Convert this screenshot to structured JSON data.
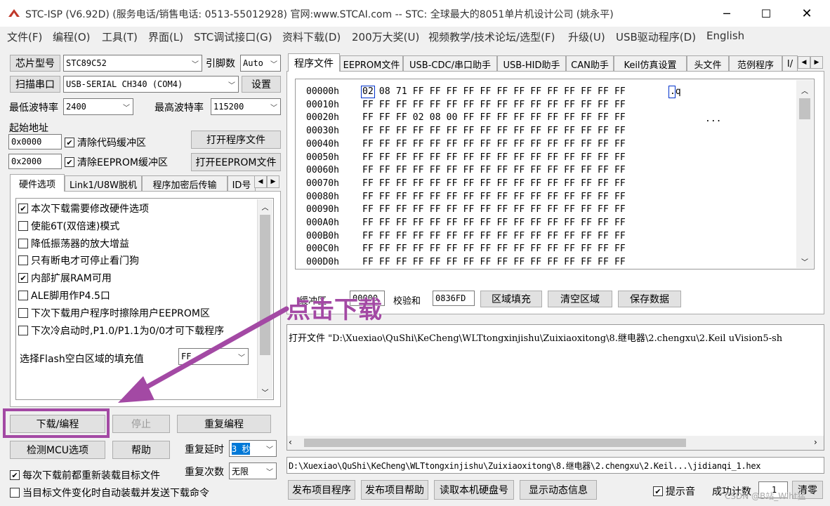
{
  "window": {
    "title": "STC-ISP (V6.92D) (服务电话/销售电话: 0513-55012928) 官网:www.STCAI.com  -- STC: 全球最大的8051单片机设计公司 (姚永平)"
  },
  "menu": [
    "文件(F)",
    "编程(O)",
    "工具(T)",
    "界面(L)",
    "STC调试接口(G)",
    "资料下载(D)",
    "200万大奖(U)",
    "视频教学/技术论坛/选型(F)",
    "升级(U)",
    "USB驱动程序(D)",
    "English"
  ],
  "left": {
    "chip_btn": "芯片型号",
    "chip_value": "STC89C52",
    "pin_label": "引脚数",
    "pin_value": "Auto",
    "scan_btn": "扫描串口",
    "port_value": "USB-SERIAL CH340 (COM4)",
    "settings_btn": "设置",
    "min_baud_label": "最低波特率",
    "min_baud_value": "2400",
    "max_baud_label": "最高波特率",
    "max_baud_value": "115200",
    "start_addr_label": "起始地址",
    "addr1": "0x0000",
    "clear_code": "清除代码缓冲区",
    "open_prog_btn": "打开程序文件",
    "addr2": "0x2000",
    "clear_eeprom": "清除EEPROM缓冲区",
    "open_eeprom_btn": "打开EEPROM文件",
    "tabs": [
      "硬件选项",
      "Link1/U8W脱机",
      "程序加密后传输",
      "ID号"
    ],
    "hw_options": [
      {
        "label": "本次下载需要修改硬件选项",
        "checked": true
      },
      {
        "label": "使能6T(双倍速)模式",
        "checked": false
      },
      {
        "label": "降低振荡器的放大增益",
        "checked": false
      },
      {
        "label": "只有断电才可停止看门狗",
        "checked": false
      },
      {
        "label": "内部扩展RAM可用",
        "checked": true
      },
      {
        "label": "ALE脚用作P4.5口",
        "checked": false
      },
      {
        "label": "下次下载用户程序时擦除用户EEPROM区",
        "checked": false
      },
      {
        "label": "下次冷启动时,P1.0/P1.1为0/0才可下载程序",
        "checked": false
      }
    ],
    "fill_label": "选择Flash空白区域的填充值",
    "fill_value": "FF",
    "download_btn": "下载/编程",
    "stop_btn": "停止",
    "reprogram_btn": "重复编程",
    "detect_btn": "检测MCU选项",
    "help_btn": "帮助",
    "repeat_delay_label": "重复延时",
    "repeat_delay_value": "3 秒",
    "reload_chk": "每次下载前都重新装载目标文件",
    "repeat_count_label": "重复次数",
    "repeat_count_value": "无限",
    "auto_chk": "当目标文件变化时自动装载并发送下载命令"
  },
  "right": {
    "tabs": [
      "程序文件",
      "EEPROM文件",
      "USB-CDC/串口助手",
      "USB-HID助手",
      "CAN助手",
      "Keil仿真设置",
      "头文件",
      "范例程序",
      "I/"
    ],
    "hex_rows": [
      [
        "00000h",
        "02 08 71 FF FF FF FF FF FF FF FF FF FF FF FF FF",
        ".q"
      ],
      [
        "00010h",
        "FF FF FF FF FF FF FF FF FF FF FF FF FF FF FF FF",
        ""
      ],
      [
        "00020h",
        "FF FF FF 02 08 00 FF FF FF FF FF FF FF FF FF FF",
        "..."
      ],
      [
        "00030h",
        "FF FF FF FF FF FF FF FF FF FF FF FF FF FF FF FF",
        ""
      ],
      [
        "00040h",
        "FF FF FF FF FF FF FF FF FF FF FF FF FF FF FF FF",
        ""
      ],
      [
        "00050h",
        "FF FF FF FF FF FF FF FF FF FF FF FF FF FF FF FF",
        ""
      ],
      [
        "00060h",
        "FF FF FF FF FF FF FF FF FF FF FF FF FF FF FF FF",
        ""
      ],
      [
        "00070h",
        "FF FF FF FF FF FF FF FF FF FF FF FF FF FF FF FF",
        ""
      ],
      [
        "00080h",
        "FF FF FF FF FF FF FF FF FF FF FF FF FF FF FF FF",
        ""
      ],
      [
        "00090h",
        "FF FF FF FF FF FF FF FF FF FF FF FF FF FF FF FF",
        ""
      ],
      [
        "000A0h",
        "FF FF FF FF FF FF FF FF FF FF FF FF FF FF FF FF",
        ""
      ],
      [
        "000B0h",
        "FF FF FF FF FF FF FF FF FF FF FF FF FF FF FF FF",
        ""
      ],
      [
        "000C0h",
        "FF FF FF FF FF FF FF FF FF FF FF FF FF FF FF FF",
        ""
      ],
      [
        "000D0h",
        "FF FF FF FF FF FF FF FF FF FF FF FF FF FF FF FF",
        ""
      ]
    ],
    "buf_label": "缓冲区",
    "buf_value": "00000",
    "checksum_label": "校验和",
    "checksum_value": "0836FD",
    "fill_btn": "区域填充",
    "clear_btn": "清空区域",
    "save_btn": "保存数据",
    "log_text": "打开文件 \"D:\\Xuexiao\\QuShi\\KeCheng\\WLTtongxinjishu\\Zuixiaoxitong\\8.继电器\\2.chengxu\\2.Keil uVision5-sh",
    "path_text": "D:\\Xuexiao\\QuShi\\KeCheng\\WLTtongxinjishu\\Zuixiaoxitong\\8.继电器\\2.chengxu\\2.Keil...\\jidianqi_1.hex",
    "publish_btn": "发布项目程序",
    "publish_help_btn": "发布项目帮助",
    "read_disk_btn": "读取本机硬盘号",
    "show_dynamic_btn": "显示动态信息",
    "beep_chk": "提示音",
    "success_label": "成功计数",
    "success_value": "1",
    "clear_count_btn": "清零"
  },
  "annotation": {
    "text": "点击下载",
    "color": "#a349a4"
  },
  "watermark": "CSDN @B站_Wiht猛"
}
